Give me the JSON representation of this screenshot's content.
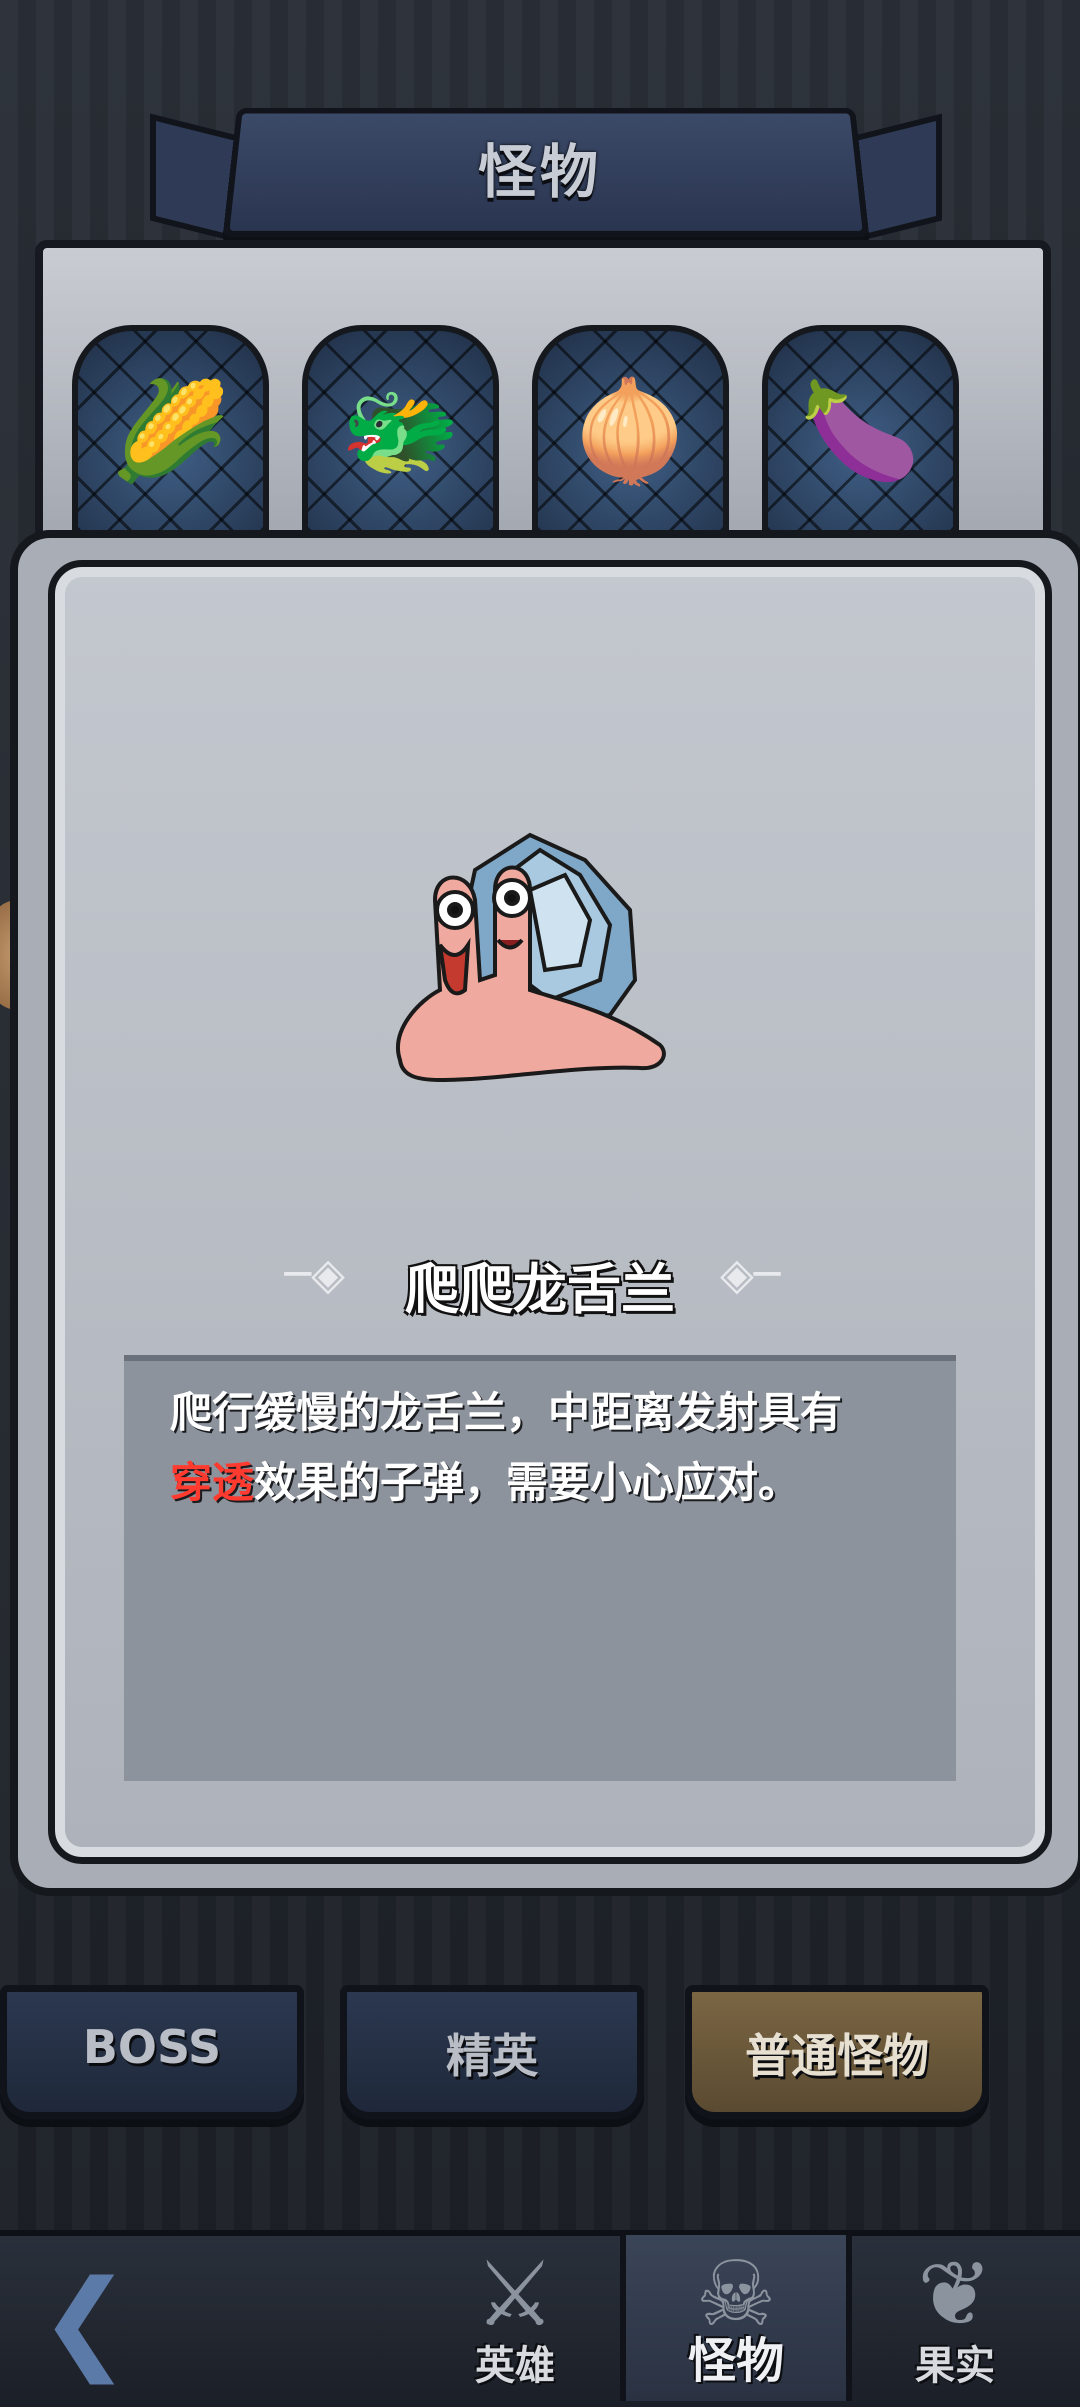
{
  "header": {
    "title": "怪物"
  },
  "gallery": {
    "items": [
      {
        "icon": "corn-monster-icon",
        "glyph": "🌽"
      },
      {
        "icon": "red-dragonfruit-monster-icon",
        "glyph": "🐲"
      },
      {
        "icon": "purple-turnip-monster-icon",
        "glyph": "🧅"
      },
      {
        "icon": "eggplant-monster-icon",
        "glyph": "🍆"
      }
    ]
  },
  "detail": {
    "monster_icon": "crawling-agave-snail-icon",
    "name": "爬爬龙舌兰",
    "description_lead": "爬行缓慢的龙舌兰，中距离发射具有",
    "description_highlight": "穿透",
    "description_tail": "效果的子弹，需要小心应对。",
    "highlight_color": "#ff3b30"
  },
  "tabs": [
    {
      "label": "BOSS",
      "active": false
    },
    {
      "label": "精英",
      "active": false
    },
    {
      "label": "普通怪物",
      "active": true
    }
  ],
  "bottom_nav": {
    "back_icon": "back-arrow-icon",
    "items": [
      {
        "label": "英雄",
        "icon": "hero-icon",
        "active": false
      },
      {
        "label": "怪物",
        "icon": "monster-icon",
        "active": true
      },
      {
        "label": "果实",
        "icon": "fruit-icon",
        "active": false
      }
    ]
  }
}
